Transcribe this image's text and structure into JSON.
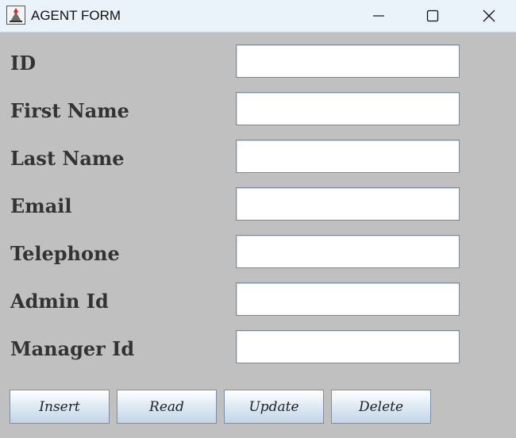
{
  "window": {
    "title": "AGENT FORM",
    "app_icon": "java-icon",
    "controls": [
      "minimize-icon",
      "maximize-icon",
      "close-icon"
    ]
  },
  "form": {
    "fields": [
      {
        "label": "ID",
        "value": ""
      },
      {
        "label": "First Name",
        "value": ""
      },
      {
        "label": "Last Name",
        "value": ""
      },
      {
        "label": "Email",
        "value": ""
      },
      {
        "label": "Telephone",
        "value": ""
      },
      {
        "label": "Admin Id",
        "value": ""
      },
      {
        "label": "Manager Id",
        "value": ""
      }
    ]
  },
  "buttons": {
    "insert": "Insert",
    "read": "Read",
    "update": "Update",
    "delete": "Delete"
  },
  "colors": {
    "background": "#c0c0c0",
    "titlebar": "#eaf2fa",
    "label_text": "#333333",
    "java_red": "#d12b2b"
  }
}
